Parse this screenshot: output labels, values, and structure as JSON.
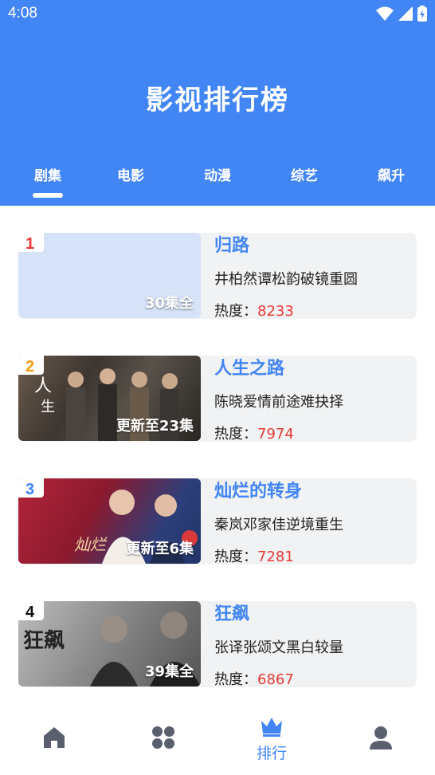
{
  "status": {
    "time": "4:08"
  },
  "header": {
    "title": "影视排行榜"
  },
  "tabs": [
    {
      "label": "剧集",
      "active": true
    },
    {
      "label": "电影",
      "active": false
    },
    {
      "label": "动漫",
      "active": false
    },
    {
      "label": "综艺",
      "active": false
    },
    {
      "label": "飙升",
      "active": false
    }
  ],
  "items": [
    {
      "rank": "1",
      "rank_color": "#e53935",
      "title": "归路",
      "episodes": "30集全",
      "desc": "井柏然谭松韵破镜重圆",
      "heat_label": "热度：",
      "heat": "8233"
    },
    {
      "rank": "2",
      "rank_color": "#f39c12",
      "title": "人生之路",
      "episodes": "更新至23集",
      "desc": "陈晓爱情前途难抉择",
      "heat_label": "热度：",
      "heat": "7974"
    },
    {
      "rank": "3",
      "rank_color": "#4285f4",
      "title": "灿烂的转身",
      "episodes": "更新至6集",
      "desc": "秦岚邓家佳逆境重生",
      "heat_label": "热度：",
      "heat": "7281"
    },
    {
      "rank": "4",
      "rank_color": "#111111",
      "title": "狂飙",
      "episodes": "39集全",
      "desc": "张译张颂文黑白较量",
      "heat_label": "热度：",
      "heat": "6867"
    }
  ],
  "bottom_nav": [
    {
      "icon": "home-icon",
      "label": "",
      "active": false
    },
    {
      "icon": "apps-icon",
      "label": "",
      "active": false
    },
    {
      "icon": "crown-icon",
      "label": "排行",
      "active": true
    },
    {
      "icon": "person-icon",
      "label": "",
      "active": false
    }
  ],
  "colors": {
    "primary": "#4285f4",
    "heat": "#e53935",
    "card_bg": "#f1f2f3"
  }
}
